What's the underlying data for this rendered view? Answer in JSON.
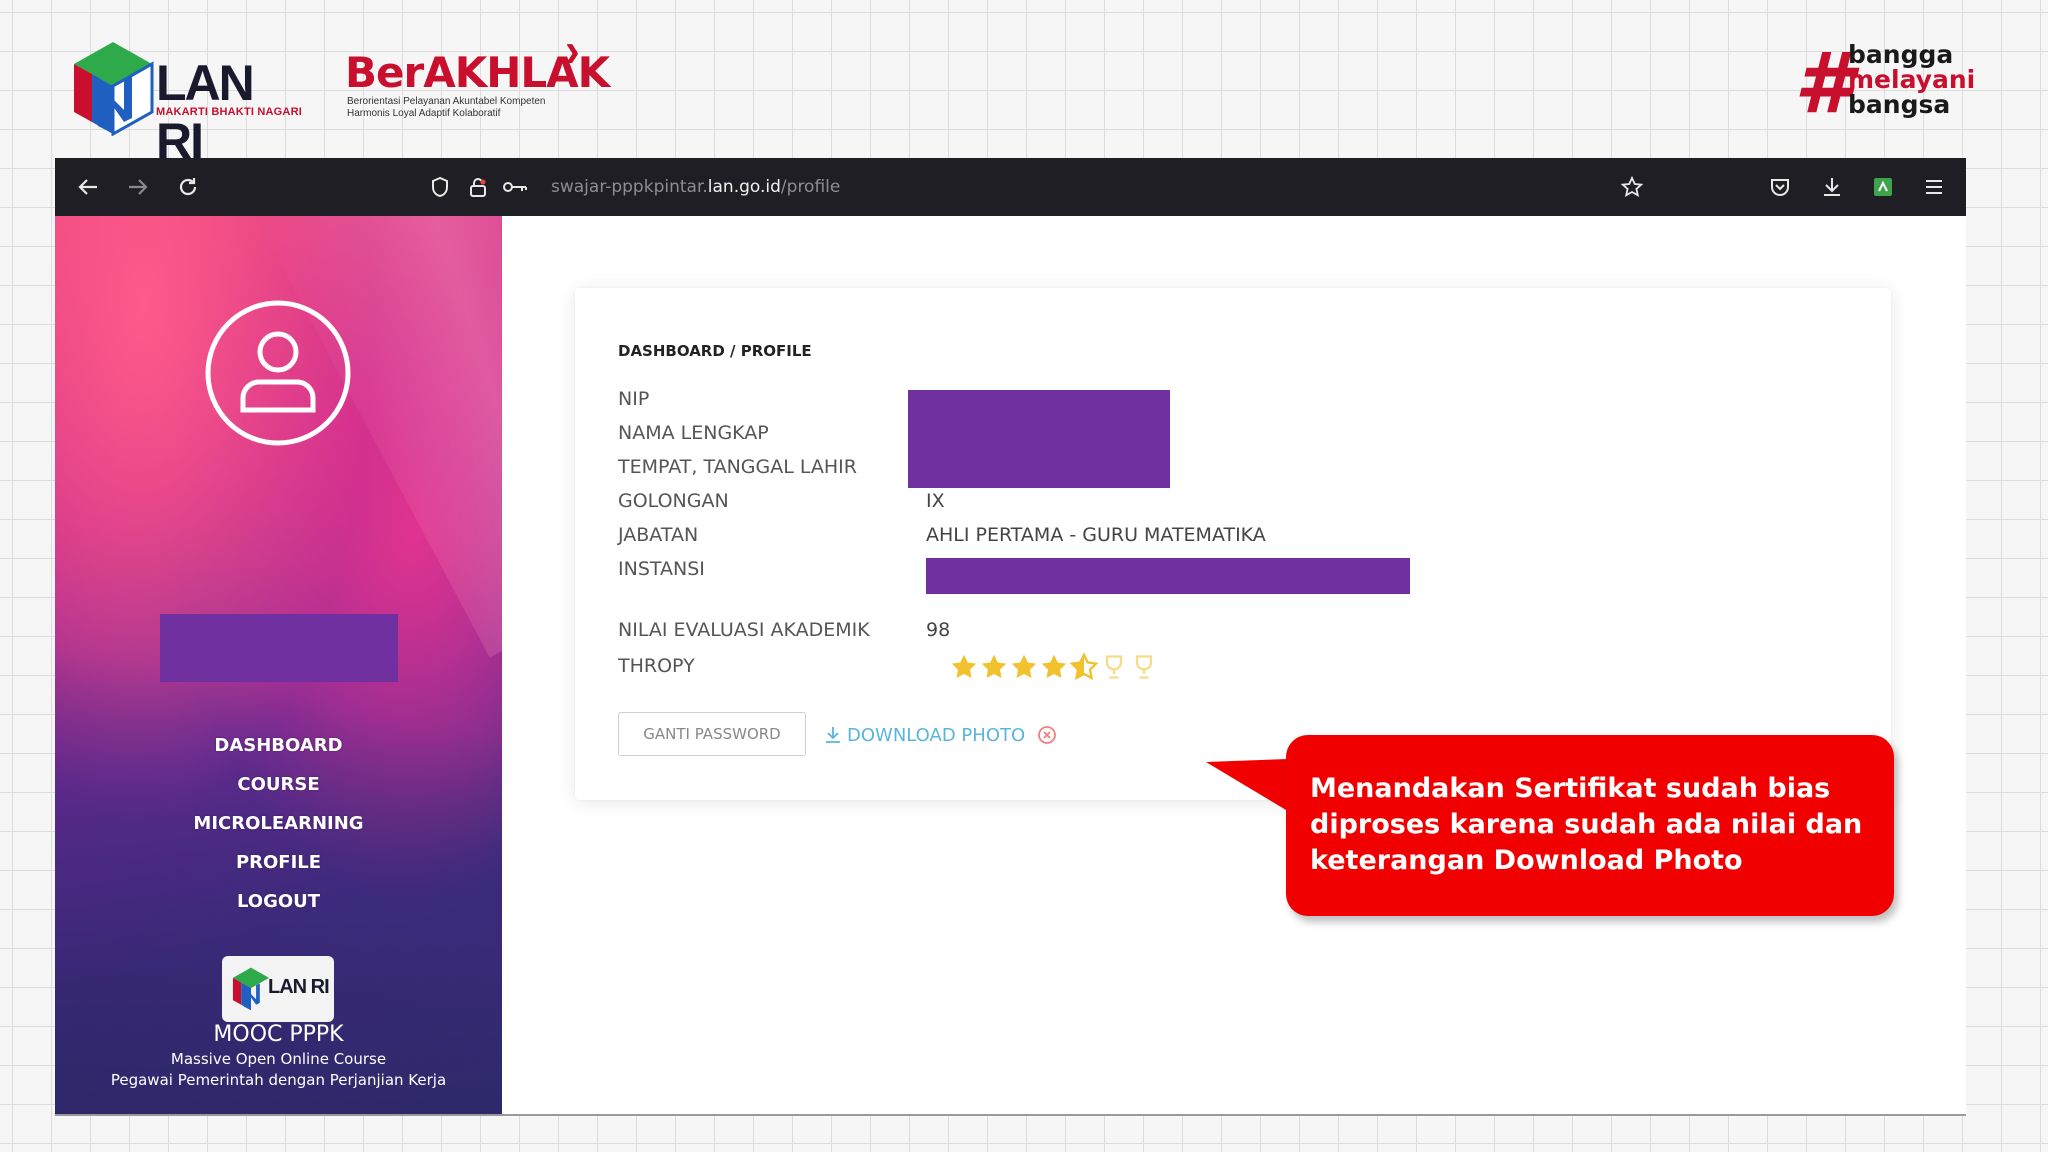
{
  "header": {
    "lanri": {
      "name": "LAN RI",
      "tagline": "MAKARTI BHAKTI NAGARI"
    },
    "berakhlak": {
      "title": "BerAKHLAK",
      "subtitle_1": "Berorientasi Pelayanan Akuntabel Kompeten",
      "subtitle_2": "Harmonis Loyal Adaptif Kolaboratif"
    },
    "bangga": {
      "hash": "#",
      "line1": "bangga",
      "line2": "melayani",
      "line3": "bangsa"
    }
  },
  "browser": {
    "url_prefix": "swajar-pppkpintar.",
    "url_domain": "lan.go.id",
    "url_path": "/profile"
  },
  "sidebar": {
    "nav": [
      "DASHBOARD",
      "COURSE",
      "MICROLEARNING",
      "PROFILE",
      "LOGOUT"
    ],
    "brand_box": "LAN RI",
    "mooc_title": "MOOC PPPK",
    "mooc_sub1": "Massive Open Online Course",
    "mooc_sub2": "Pegawai Pemerintah dengan Perjanjian Kerja"
  },
  "profile": {
    "breadcrumb": "DASHBOARD / PROFILE",
    "labels": {
      "nip": "NIP",
      "nama": "NAMA LENGKAP",
      "ttl": "TEMPAT, TANGGAL LAHIR",
      "golongan": "GOLONGAN",
      "jabatan": "JABATAN",
      "instansi": "INSTANSI",
      "nilai": "NILAI EVALUASI AKADEMIK",
      "thropy": "THROPY"
    },
    "values": {
      "golongan": "IX",
      "jabatan": "AHLI PERTAMA - GURU MATEMATIKA",
      "nilai": "98"
    },
    "trophy": {
      "stars_full": 4,
      "stars_half": 1,
      "trophies": 2
    },
    "ganti_password": "GANTI PASSWORD",
    "download_photo": "DOWNLOAD PHOTO"
  },
  "callout": {
    "text": "Menandakan Sertifikat sudah bias diproses karena sudah ada nilai dan keterangan Download Photo"
  },
  "colors": {
    "brand_red": "#c8102e",
    "redaction": "#7030a0",
    "callout_red": "#f00000",
    "link_blue": "#5ab4de",
    "star_gold": "#f2c12e"
  },
  "icons": [
    "back-arrow-icon",
    "forward-arrow-icon",
    "reload-icon",
    "shield-icon",
    "lock-icon",
    "key-icon",
    "star-bookmark-icon",
    "pocket-icon",
    "download-icon",
    "extension-icon",
    "menu-icon",
    "user-avatar-icon",
    "download-small-icon",
    "close-circle-icon",
    "star-icon",
    "trophy-icon"
  ]
}
